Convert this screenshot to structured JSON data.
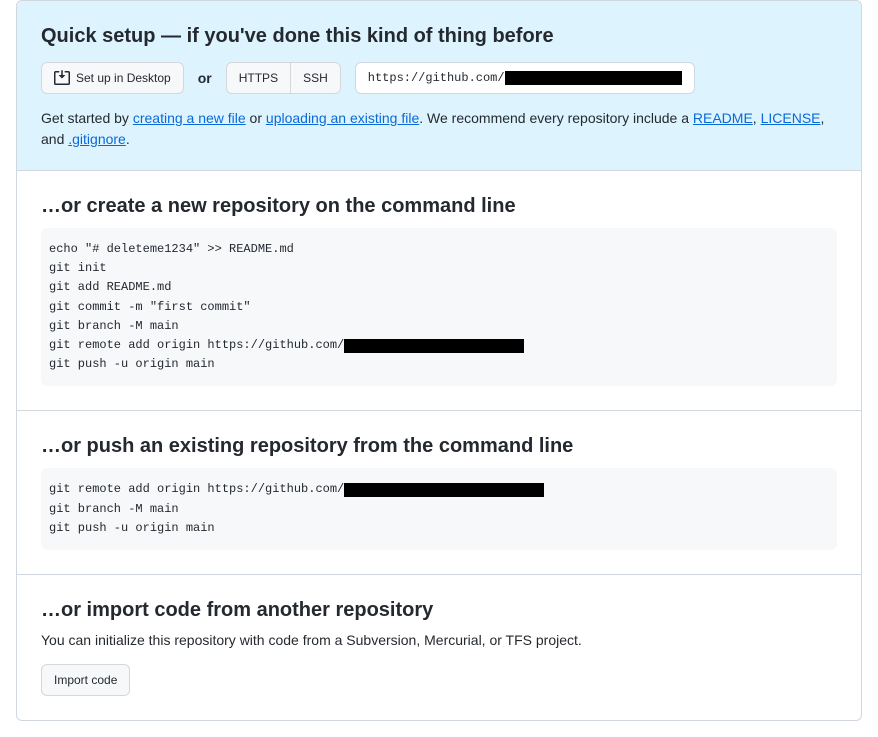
{
  "quick_setup": {
    "title": "Quick setup — if you've done this kind of thing before",
    "desktop_btn": "Set up in Desktop",
    "or": "or",
    "https_btn": "HTTPS",
    "ssh_btn": "SSH",
    "url_prefix": "https://github.com/",
    "text_start": "Get started by ",
    "link_create": "creating a new file",
    "text_or": " or ",
    "link_upload": "uploading an existing file",
    "text_rec": ". We recommend every repository include a ",
    "link_readme": "README",
    "text_comma": ", ",
    "link_license": "LICENSE",
    "text_and": ", and ",
    "link_gitignore": ".gitignore",
    "text_period": "."
  },
  "create_repo": {
    "title": "…or create a new repository on the command line",
    "lines": [
      "echo \"# deleteme1234\" >> README.md",
      "git init",
      "git add README.md",
      "git commit -m \"first commit\"",
      "git branch -M main"
    ],
    "remote_prefix": "git remote add origin https://github.com/",
    "last_line": "git push -u origin main"
  },
  "push_repo": {
    "title": "…or push an existing repository from the command line",
    "remote_prefix": "git remote add origin https://github.com/",
    "lines": [
      "git branch -M main",
      "git push -u origin main"
    ]
  },
  "import": {
    "title": "…or import code from another repository",
    "desc": "You can initialize this repository with code from a Subversion, Mercurial, or TFS project.",
    "btn": "Import code"
  }
}
